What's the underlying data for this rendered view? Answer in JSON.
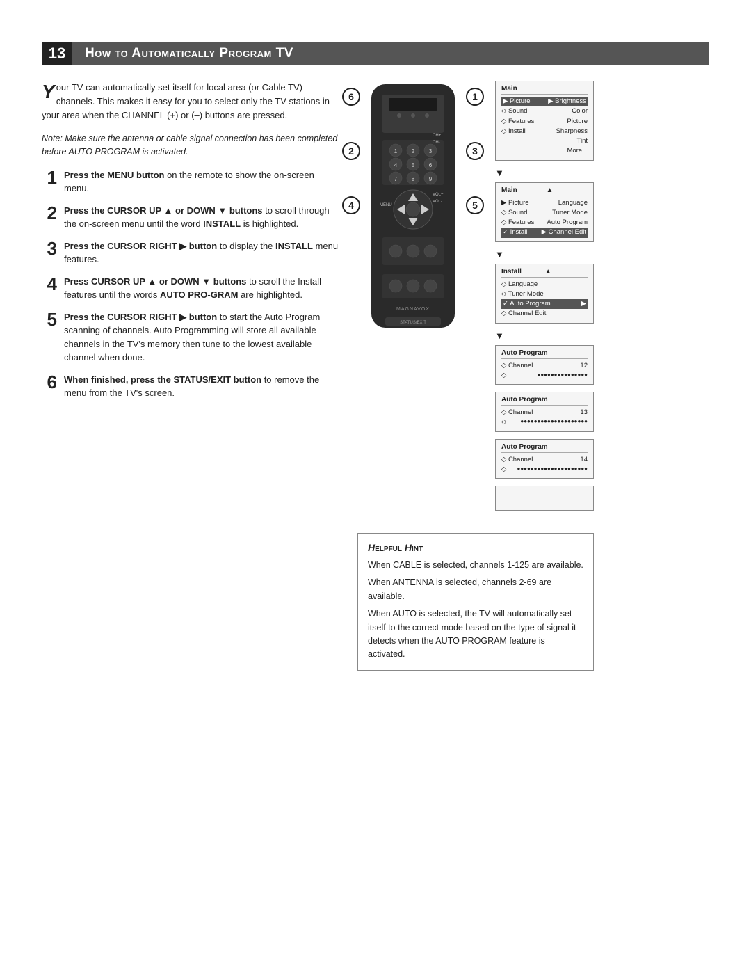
{
  "header": {
    "number": "13",
    "title": "How to Automatically Program TV"
  },
  "intro": {
    "drop_cap": "Y",
    "text": "our TV can automatically set itself for local area (or Cable TV) channels. This makes it easy for you to select only the TV stations in your area when the CHANNEL (+) or (–) buttons are pressed."
  },
  "note": {
    "text": "Note: Make sure the antenna or cable signal connection has been completed before AUTO PROGRAM is activated."
  },
  "steps": [
    {
      "number": "1",
      "bold_start": "Press the MENU button",
      "rest": " on the remote to show the on-screen menu."
    },
    {
      "number": "2",
      "bold_start": "Press the CURSOR UP ▲ or DOWN ▼ buttons",
      "rest": " to scroll through the on-screen menu until the word INSTALL is highlighted."
    },
    {
      "number": "3",
      "bold_start": "Press the CURSOR RIGHT ▶ button",
      "rest": " to display the INSTALL menu features."
    },
    {
      "number": "4",
      "bold_start": "Press CURSOR UP ▲ or DOWN ▼ buttons",
      "rest": " to scroll the Install features until the words AUTO PRO-GRAM are highlighted."
    },
    {
      "number": "5",
      "bold_start": "Press the CURSOR RIGHT ▶ button",
      "rest": " to start the Auto Program scanning of channels. Auto Programming will store all available channels in the TV's memory then tune to the lowest available channel when done."
    },
    {
      "number": "6",
      "bold_start": "When finished, press the STATUS/EXIT button",
      "rest": " to remove the menu from the TV's screen."
    }
  ],
  "step_labels": {
    "left": [
      "6",
      "2",
      "4"
    ],
    "right": [
      "1",
      "3",
      "5"
    ]
  },
  "screens": [
    {
      "id": "screen1",
      "title": "Main",
      "rows": [
        {
          "label": "▶ Picture",
          "value": "▶ Brightness",
          "highlight": false
        },
        {
          "label": "◇ Sound",
          "value": "Color",
          "highlight": false
        },
        {
          "label": "◇ Features",
          "value": "Picture",
          "highlight": false
        },
        {
          "label": "◇ Install",
          "value": "Sharpness",
          "highlight": false
        },
        {
          "label": "",
          "value": "Tint",
          "highlight": false
        },
        {
          "label": "",
          "value": "More...",
          "highlight": false
        }
      ]
    },
    {
      "id": "screen2",
      "title": "Main",
      "rows": [
        {
          "label": "▲",
          "value": "",
          "highlight": false
        },
        {
          "label": "▶ Picture",
          "value": "Language",
          "highlight": false
        },
        {
          "label": "◇ Sound",
          "value": "Tuner Mode",
          "highlight": false
        },
        {
          "label": "◇ Features",
          "value": "Auto Program",
          "highlight": false
        },
        {
          "label": "✓ Install",
          "value": "▶ Channel Edit",
          "highlight": true
        }
      ]
    },
    {
      "id": "screen3",
      "title": "Install",
      "rows": [
        {
          "label": "▲",
          "value": "",
          "highlight": false
        },
        {
          "label": "◇ Language",
          "value": "",
          "highlight": false
        },
        {
          "label": "◇ Tuner Mode",
          "value": "",
          "highlight": false
        },
        {
          "label": "✓ Auto Program",
          "value": "▶",
          "highlight": true
        },
        {
          "label": "◇ Channel Edit",
          "value": "",
          "highlight": false
        }
      ]
    },
    {
      "id": "screen4",
      "title": "Auto Program",
      "rows": [
        {
          "label": "◇ Channel",
          "value": "12",
          "highlight": false
        },
        {
          "label": "◇",
          "value": "●●●●●●●●●●●●●●●",
          "highlight": false
        }
      ]
    },
    {
      "id": "screen5",
      "title": "Auto Program",
      "rows": [
        {
          "label": "◇ Channel",
          "value": "13",
          "highlight": false
        },
        {
          "label": "◇",
          "value": "●●●●●●●●●●●●●●●●●●●●",
          "highlight": false
        }
      ]
    },
    {
      "id": "screen6",
      "title": "Auto Program",
      "rows": [
        {
          "label": "◇ Channel",
          "value": "14",
          "highlight": false
        },
        {
          "label": "◇",
          "value": "●●●●●●●●●●●●●●●●●●●●●",
          "highlight": false
        }
      ]
    },
    {
      "id": "screen7",
      "title": "",
      "rows": []
    }
  ],
  "hint": {
    "title": "Helpful Hint",
    "lines": [
      "When CABLE is selected, channels 1-125 are available.",
      "When ANTENNA is selected, channels 2-69 are available.",
      "When AUTO is selected, the TV will automatically set itself to the correct mode based on the type of signal it detects when the AUTO PROGRAM feature is activated."
    ]
  }
}
